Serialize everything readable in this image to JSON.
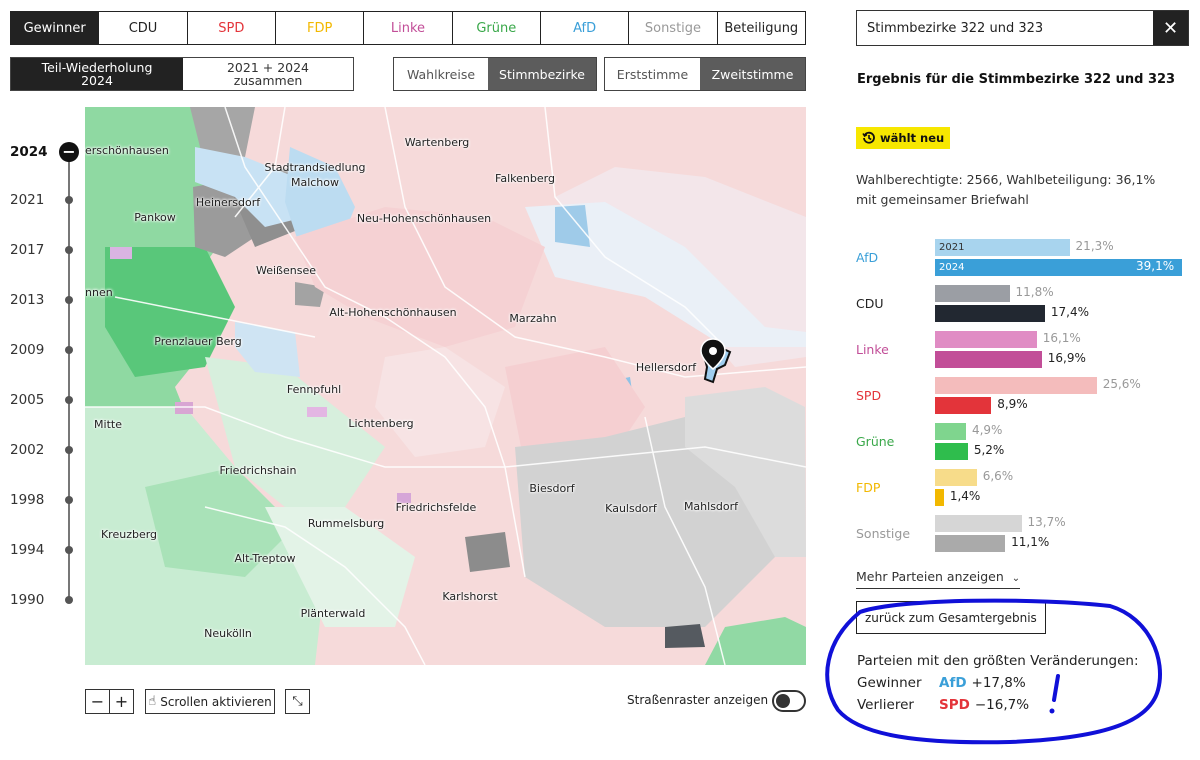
{
  "party_tabs": [
    {
      "label": "Gewinner",
      "color": "#ffffff",
      "active": true
    },
    {
      "label": "CDU",
      "color": "#222222"
    },
    {
      "label": "SPD",
      "color": "#e3343a"
    },
    {
      "label": "FDP",
      "color": "#f2b800"
    },
    {
      "label": "Linke",
      "color": "#c24e98"
    },
    {
      "label": "Grüne",
      "color": "#3aa84a"
    },
    {
      "label": "AfD",
      "color": "#3a9fd8"
    },
    {
      "label": "Sonstige",
      "color": "#999999"
    },
    {
      "label": "Beteiligung",
      "color": "#222222"
    }
  ],
  "election_toggle": {
    "option1_line1": "Teil-Wiederholung",
    "option1_line2": "2024",
    "option2_line1": "2021 + 2024",
    "option2_line2": "zusammen"
  },
  "area_toggle": {
    "option1": "Wahlkreise",
    "option2": "Stimmbezirke"
  },
  "vote_toggle": {
    "option1": "Erststimme",
    "option2": "Zweitstimme"
  },
  "timeline": {
    "current_symbol": "−",
    "years": [
      "2024",
      "2021",
      "2017",
      "2013",
      "2009",
      "2005",
      "2002",
      "1998",
      "1994",
      "1990"
    ]
  },
  "map": {
    "labels": {
      "prenzlauer_schoenhausen": "erschönhausen",
      "wartenberg": "Wartenberg",
      "stadtrandsiedlung": "Stadtrandsiedlung",
      "malchow": "Malchow",
      "falkenberg": "Falkenberg",
      "heinersdorf": "Heinersdorf",
      "pankow": "Pankow",
      "neu_hohenschoenhausen": "Neu-Hohenschönhausen",
      "weissensee": "Weißensee",
      "brunnen": "nnen",
      "alt_hohenschoenhausen": "Alt-Hohenschönhausen",
      "marzahn": "Marzahn",
      "prenzlauer_berg": "Prenzlauer Berg",
      "hellersdorf": "Hellersdorf",
      "fennpfuhl": "Fennpfuhl",
      "mitte": "Mitte",
      "lichtenberg": "Lichtenberg",
      "friedrichshain": "Friedrichshain",
      "biesdorf": "Biesdorf",
      "friedrichsfelde": "Friedrichsfelde",
      "kaulsdorf": "Kaulsdorf",
      "mahlsdorf": "Mahlsdorf",
      "kreuzberg": "Kreuzberg",
      "rummelsburg": "Rummelsburg",
      "alt_treptow": "Alt-Treptow",
      "karlshorst": "Karlshorst",
      "plaenterwald": "Plänterwald",
      "neukoelln": "Neukölln"
    }
  },
  "map_controls": {
    "zoom_out": "−",
    "zoom_in": "+",
    "scroll_label": "Scrollen aktivieren",
    "street_grid_label": "Straßenraster anzeigen",
    "street_grid_on": false
  },
  "search": {
    "value": "Stimmbezirke 322 und 323",
    "close_symbol": "✕"
  },
  "result": {
    "title": "Ergebnis für die Stimmbezirke 322 und 323",
    "badge": "wählt neu",
    "stats_line1": "Wahlberechtigte: 2566, Wahlbeteiligung: 36,1%",
    "stats_line2": "mit gemeinsamer Briefwahl"
  },
  "results": [
    {
      "party": "AfD",
      "color": "#3a9fd8",
      "color_prev": "#a8d4ee",
      "prev": 21.3,
      "curr": 39.1,
      "prev_label": "21,3%",
      "curr_label": "39,1%",
      "prev_tag": "2021",
      "curr_tag": "2024"
    },
    {
      "party": "CDU",
      "color": "#222831",
      "color_prev": "#9b9ea4",
      "prev": 11.8,
      "curr": 17.4,
      "prev_label": "11,8%",
      "curr_label": "17,4%"
    },
    {
      "party": "Linke",
      "color": "#c24e98",
      "color_prev": "#e08cc4",
      "prev": 16.1,
      "curr": 16.9,
      "prev_label": "16,1%",
      "curr_label": "16,9%"
    },
    {
      "party": "SPD",
      "color": "#e3343a",
      "color_prev": "#f4bcbc",
      "prev": 25.6,
      "curr": 8.9,
      "prev_label": "25,6%",
      "curr_label": "8,9%"
    },
    {
      "party": "Grüne",
      "color": "#2fbd4d",
      "color_prev": "#7fd58e",
      "prev": 4.9,
      "curr": 5.2,
      "prev_label": "4,9%",
      "curr_label": "5,2%"
    },
    {
      "party": "FDP",
      "color": "#f2b800",
      "color_prev": "#f7dc8a",
      "prev": 6.6,
      "curr": 1.4,
      "prev_label": "6,6%",
      "curr_label": "1,4%"
    },
    {
      "party": "Sonstige",
      "color": "#aaaaaa",
      "color_prev": "#d6d6d6",
      "prev": 13.7,
      "curr": 11.1,
      "prev_label": "13,7%",
      "curr_label": "11,1%"
    }
  ],
  "more_parties": "Mehr Parteien anzeigen",
  "back_button": "zurück zum Gesamtergebnis",
  "changes": {
    "title": "Parteien mit den größten Veränderungen:",
    "winner_label": "Gewinner",
    "winner_party": "AfD",
    "winner_value": "+17,8%",
    "winner_color": "#3a9fd8",
    "loser_label": "Verlierer",
    "loser_party": "SPD",
    "loser_value": "−16,7%",
    "loser_color": "#e3343a"
  }
}
